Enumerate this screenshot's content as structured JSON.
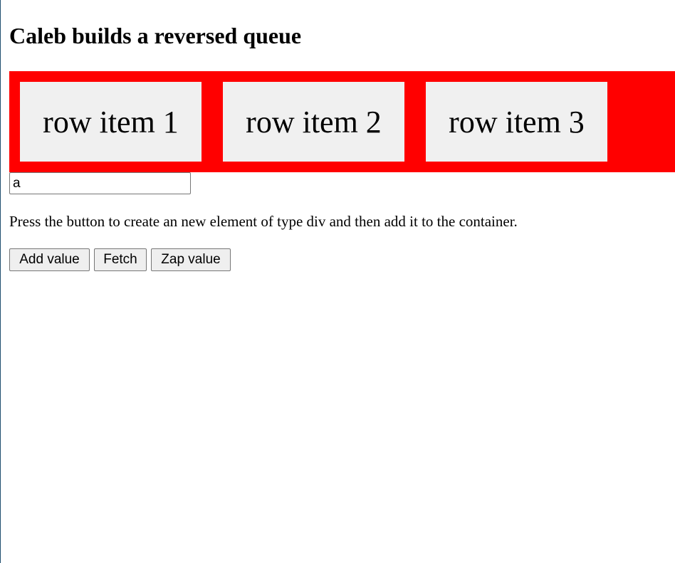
{
  "page": {
    "title": "Caleb builds a reversed queue"
  },
  "container": {
    "background_color": "#ff0000",
    "items": [
      {
        "label": "row item 1"
      },
      {
        "label": "row item 2"
      },
      {
        "label": "row item 3"
      }
    ]
  },
  "value_input": {
    "value": "a"
  },
  "description": "Press the button to create an new element of type div and then add it to the container.",
  "buttons": {
    "add_label": "Add value",
    "fetch_label": "Fetch",
    "zap_label": "Zap value"
  }
}
